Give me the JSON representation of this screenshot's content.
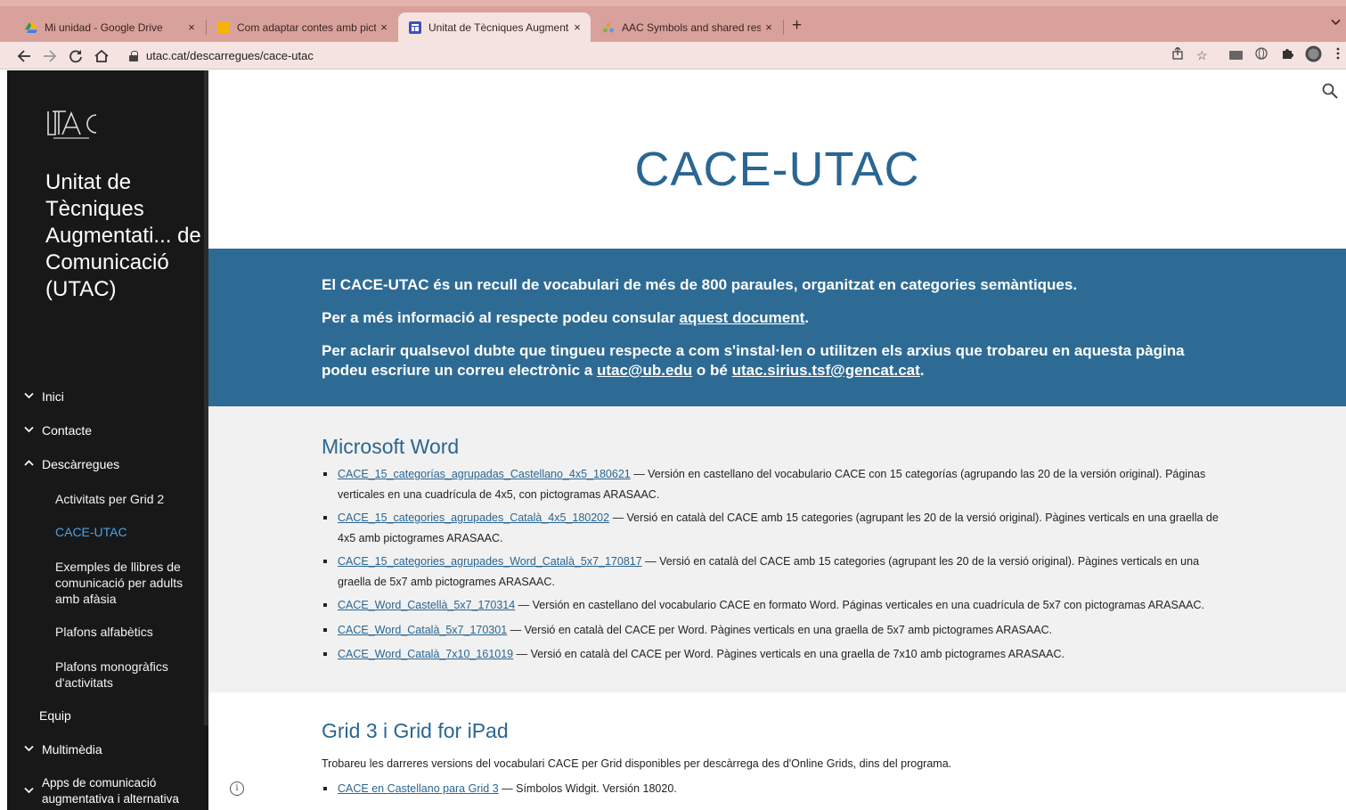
{
  "browser": {
    "tabs": [
      {
        "title": "Mi unidad - Google Drive",
        "favicon": "google-drive-icon",
        "active": false
      },
      {
        "title": "Com adaptar contes amb picto",
        "favicon": "google-slides-icon",
        "active": false
      },
      {
        "title": "Unitat de Tècniques Augmenta",
        "favicon": "google-sites-icon",
        "active": true
      },
      {
        "title": "AAC Symbols and shared reso",
        "favicon": "globalsymbols-icon",
        "active": false
      }
    ],
    "close_glyph": "×",
    "new_tab_glyph": "+",
    "url": "utac.cat/descarregues/cace-utac",
    "colors": {
      "tabbar": "#d9a19b",
      "toolbar": "#f4e3e0"
    }
  },
  "sidebar": {
    "logo_text": "UTAC",
    "site_title": "Unitat de Tècniques Augmentati... de Comunicació (UTAC)",
    "nav": [
      {
        "label": "Inici",
        "chevron": "down"
      },
      {
        "label": "Contacte",
        "chevron": "down"
      },
      {
        "label": "Descàrregues",
        "chevron": "up"
      },
      {
        "label": "Activitats per Grid 2",
        "sub": true
      },
      {
        "label": "CACE-UTAC",
        "sub": true,
        "current": true
      },
      {
        "label": "Exemples de llibres de comunicació per adults amb afàsia",
        "sub": true
      },
      {
        "label": "Plafons alfabètics",
        "sub": true
      },
      {
        "label": "Plafons monogràfics d'activitats",
        "sub": true
      },
      {
        "label": "Equip",
        "chevron": "none"
      },
      {
        "label": "Multimèdia",
        "chevron": "down"
      },
      {
        "label": "Apps de comunicació augmentativa i alternativa",
        "chevron": "down"
      }
    ],
    "colors": {
      "background": "#181818",
      "current": "#4aa3e6"
    }
  },
  "main": {
    "title": "CACE-UTAC",
    "intro": {
      "p1": "El CACE-UTAC és un recull de vocabulari de més de 800 paraules, organitzat en categories semàntiques.",
      "p2_before": "Per a més informació al respecte podeu consular ",
      "p2_link": "aquest document",
      "p2_after": ".",
      "p3_before": "Per aclarir qualsevol dubte que tingueu respecte a com s'instal·len o utilitzen els arxius que trobareu en aquesta pàgina podeu escriure un correu electrònic a ",
      "p3_link1": "utac@ub.edu",
      "p3_mid": " o bé ",
      "p3_link2": "utac.sirius.tsf@gencat.cat",
      "p3_after": "."
    },
    "word_section": {
      "heading": "Microsoft Word",
      "items": [
        {
          "link": "CACE_15_categorías_agrupadas_Castellano_4x5_180621",
          "desc": " — Versión en castellano del vocabulario CACE con 15 categorías (agrupando las 20 de la versión original). Páginas verticales en una cuadrícula de 4x5, con pictogramas ARASAAC."
        },
        {
          "link": "CACE_15_categories_agrupades_Català_4x5_180202",
          "desc": " — Versió en català del CACE amb 15 categories (agrupant les 20 de la versió original). Pàgines verticals en una graella de 4x5 amb pictogrames ARASAAC."
        },
        {
          "link": "CACE_15_categories_agrupades_Word_Català_5x7_170817",
          "desc": " — Versió en català del CACE amb 15 categories (agrupant les 20 de la versió original). Pàgines verticals en una graella de 5x7 amb pictogrames ARASAAC."
        },
        {
          "link": "CACE_Word_Castellà_5x7_170314",
          "desc": " — Versión en castellano del vocabulario CACE en formato Word. Páginas verticales en una cuadrícula de 5x7 con pictogramas ARASAAC."
        },
        {
          "link": "CACE_Word_Català_5x7_170301",
          "desc": " — Versió en català del CACE per Word. Pàgines verticals en una graella de 5x7 amb pictogrames ARASAAC."
        },
        {
          "link": "CACE_Word_Català_7x10_161019",
          "desc": " — Versió en català del CACE per Word. Pàgines verticals en una graella de 7x10 amb pictogrames ARASAAC."
        }
      ]
    },
    "grid_section": {
      "heading": "Grid 3 i Grid for iPad",
      "desc": "Trobareu les darreres versions del vocabulari CACE per Grid disponibles per descàrrega des d'Online Grids, dins del programa.",
      "items": [
        {
          "link": "CACE en Castellano para Grid 3",
          "desc": " — Símbolos Widgit. Versión 18020."
        }
      ]
    },
    "colors": {
      "accent": "#2a6692",
      "band": "#2e6b94",
      "section_bg": "#f1f1f1"
    }
  }
}
